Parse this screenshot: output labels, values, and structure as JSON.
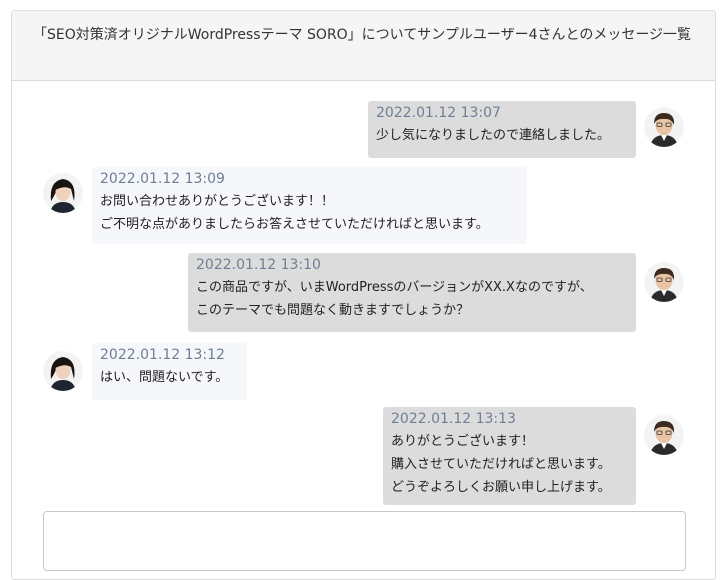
{
  "header": {
    "title": "「SEO対策済オリジナルWordPressテーマ SORO」についてサンプルユーザー4さんとのメッセージ一覧"
  },
  "messages": [
    {
      "sender": "me",
      "timestamp": "2022.01.12 13:07",
      "lines": [
        "少し気になりましたので連絡しました。"
      ]
    },
    {
      "sender": "them",
      "timestamp": "2022.01.12 13:09",
      "lines": [
        "お問い合わせありがとうございます！！",
        "ご不明な点がありましたらお答えさせていただければと思います。"
      ]
    },
    {
      "sender": "me",
      "timestamp": "2022.01.12 13:10",
      "lines": [
        "この商品ですが、いまWordPressのバージョンがXX.Xなのですが、",
        "このテーマでも問題なく動きますでしょうか？"
      ]
    },
    {
      "sender": "them",
      "timestamp": "2022.01.12 13:12",
      "lines": [
        "はい、問題ないです。"
      ]
    },
    {
      "sender": "me",
      "timestamp": "2022.01.12 13:13",
      "lines": [
        "ありがとうございます！",
        "購入させていただければと思います。",
        "どうぞよろしくお願い申し上げます。"
      ]
    }
  ],
  "reply": {
    "value": "",
    "placeholder": ""
  },
  "colors": {
    "my_bubble": "#dcdcdc",
    "their_bubble": "#f5f7fa",
    "timestamp": "#6f7f95",
    "header_bg": "#f5f5f5"
  }
}
